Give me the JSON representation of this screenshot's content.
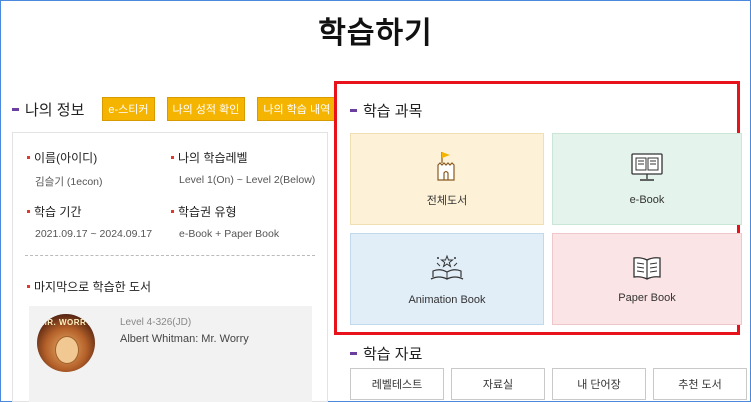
{
  "page": {
    "title": "학습하기"
  },
  "my_info": {
    "heading": "나의 정보",
    "buttons": [
      "e-스티커",
      "나의 성적 확인",
      "나의 학습 내역"
    ],
    "name_label": "이름(아이디)",
    "name_value": "김슬기 (1econ)",
    "level_label": "나의 학습레벨",
    "level_value": "Level 1(On) ~ Level 2(Below)",
    "period_label": "학습 기간",
    "period_value": "2021.09.17 ~ 2024.09.17",
    "type_label": "학습권 유형",
    "type_value": "e-Book + Paper Book",
    "last_label": "마지막으로 학습한 도서",
    "last_book": {
      "cover_title": "MR. WORRY",
      "level": "Level 4-326(JD)",
      "title": "Albert Whitman: Mr. Worry"
    }
  },
  "subjects": {
    "heading": "학습 과목",
    "tiles": [
      {
        "label": "전체도서",
        "icon": "castle-flag-icon"
      },
      {
        "label": "e-Book",
        "icon": "ebook-monitor-icon"
      },
      {
        "label": "Animation Book",
        "icon": "magic-book-icon"
      },
      {
        "label": "Paper Book",
        "icon": "paper-book-icon"
      }
    ],
    "highlight_color": "#e8121b"
  },
  "materials": {
    "heading": "학습 자료",
    "buttons": [
      "레벨테스트",
      "자료실",
      "내 단어장",
      "추천 도서"
    ]
  },
  "colors": {
    "accent_yellow": "#f5b400",
    "section_bar": "#6a3fa0",
    "frame_blue": "#4a89dc"
  }
}
